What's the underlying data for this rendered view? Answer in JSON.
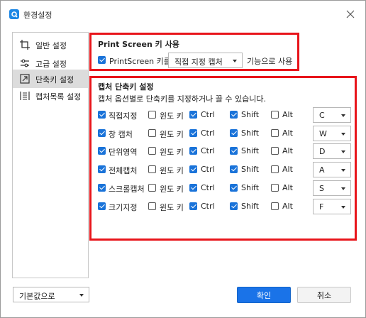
{
  "window": {
    "title": "환경설정"
  },
  "sidebar": {
    "items": [
      {
        "label": "일반 설정"
      },
      {
        "label": "고급 설정"
      },
      {
        "label": "단축키 설정"
      },
      {
        "label": "캡처목록 설정"
      }
    ]
  },
  "printscreen": {
    "title": "Print Screen 키 사용",
    "checkbox_label": "PrintScreen 키를",
    "select_value": "직접 지정 캡처",
    "suffix": "기능으로 사용"
  },
  "shortcuts": {
    "title": "캡처 단축키 설정",
    "description": "캡처 옵션별로 단축키를 지정하거나 끌 수 있습니다.",
    "rows": [
      {
        "name": "직접지정",
        "win": "윈도 키",
        "ctrl": "Ctrl",
        "shift": "Shift",
        "alt": "Alt",
        "key": "C"
      },
      {
        "name": "창 캡처",
        "win": "윈도 키",
        "ctrl": "Ctrl",
        "shift": "Shift",
        "alt": "Alt",
        "key": "W"
      },
      {
        "name": "단위영역",
        "win": "윈도 키",
        "ctrl": "Ctrl",
        "shift": "Shift",
        "alt": "Alt",
        "key": "D"
      },
      {
        "name": "전체캡처",
        "win": "윈도 키",
        "ctrl": "Ctrl",
        "shift": "Shift",
        "alt": "Alt",
        "key": "A"
      },
      {
        "name": "스크롤캡처",
        "win": "윈도 키",
        "ctrl": "Ctrl",
        "shift": "Shift",
        "alt": "Alt",
        "key": "S"
      },
      {
        "name": "크기지정",
        "win": "윈도 키",
        "ctrl": "Ctrl",
        "shift": "Shift",
        "alt": "Alt",
        "key": "F"
      }
    ]
  },
  "footer": {
    "defaults_select": "기본값으로",
    "ok_label": "확인",
    "cancel_label": "취소"
  },
  "colors": {
    "accent": "#1a73e8",
    "highlight": "#e8151b"
  }
}
